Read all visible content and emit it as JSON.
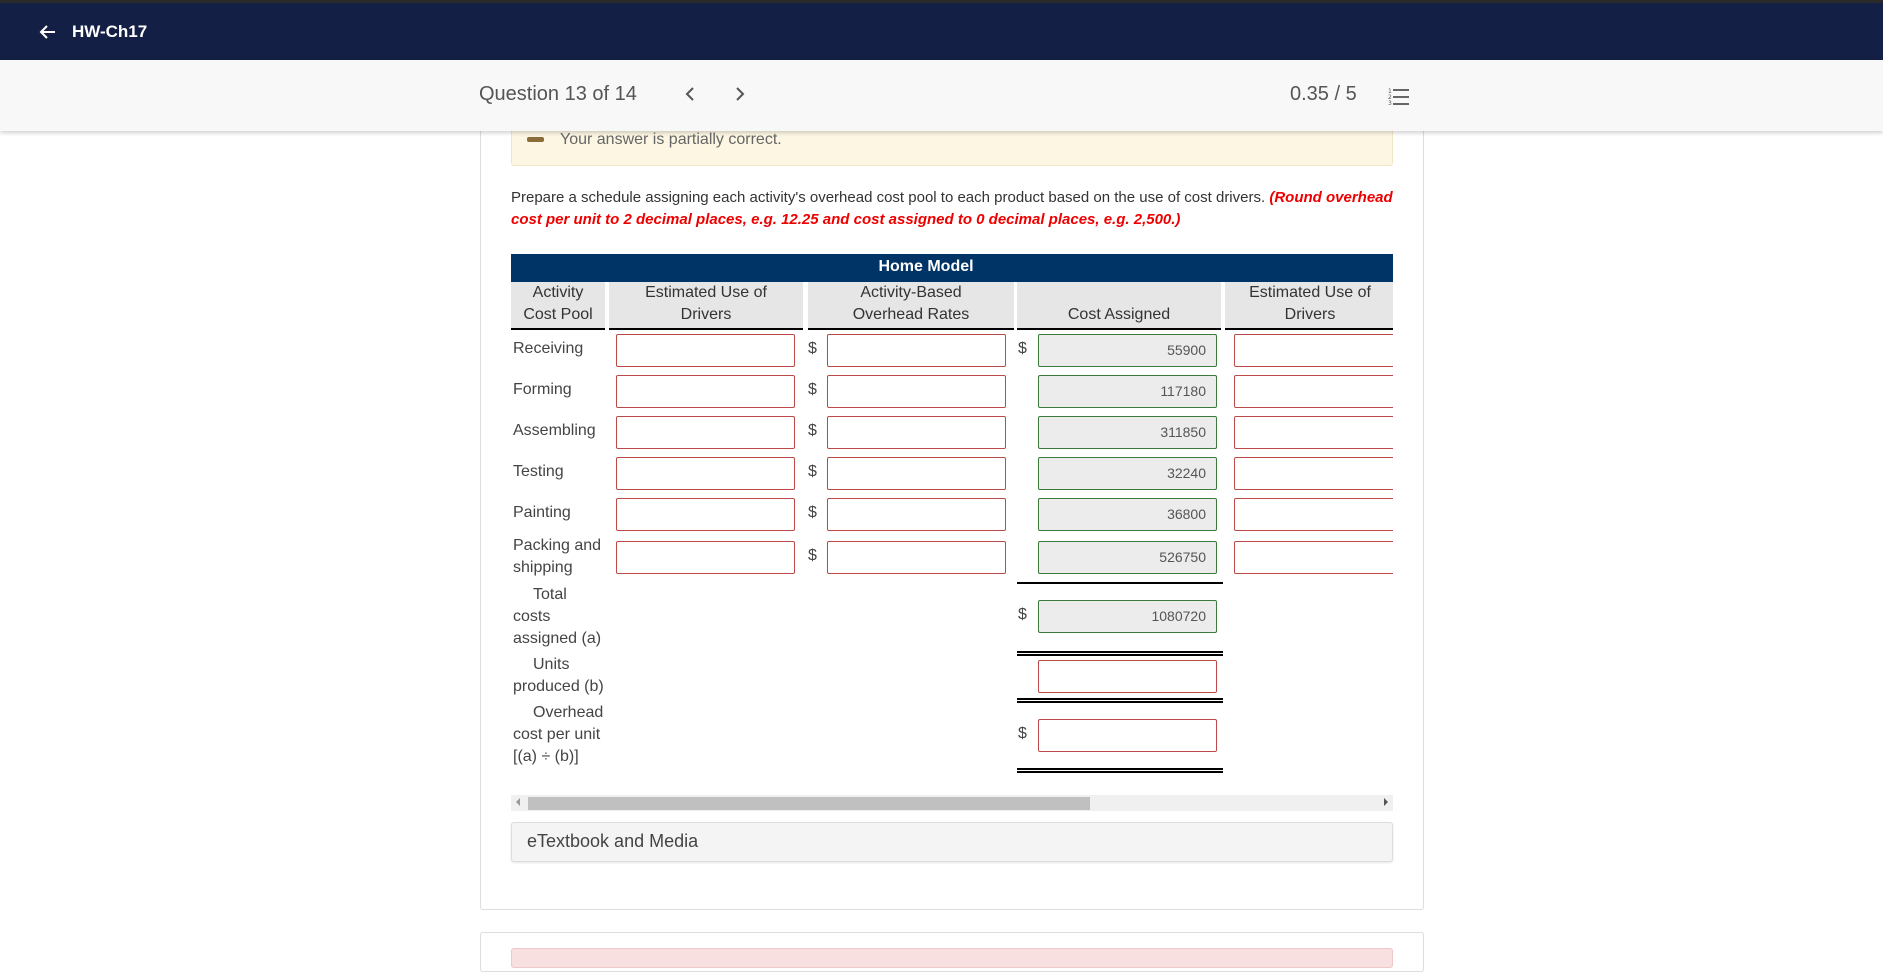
{
  "nav": {
    "title": "HW-Ch17"
  },
  "question_bar": {
    "question_label": "Question 13 of 14",
    "score": "0.35 / 5"
  },
  "alert": {
    "message": "Your answer is partially correct."
  },
  "instructions": {
    "text": "Prepare a schedule assigning each activity's overhead cost pool to each product based on the use of cost drivers. ",
    "note": "(Round overhead cost per unit to 2 decimal places, e.g. 12.25 and cost assigned to 0 decimal places, e.g. 2,500.)"
  },
  "table": {
    "group_header": "Home Model",
    "headers": {
      "activity_line1": "Activity",
      "activity_line2": "Cost Pool",
      "drivers_line1": "Estimated Use of",
      "drivers_line2": "Drivers",
      "rates_line1": "Activity-Based",
      "rates_line2": "Overhead Rates",
      "cost_assigned": "Cost Assigned",
      "next_drivers_line1": "Estimated Use of",
      "next_drivers_line2": "Drivers"
    },
    "currency": "$",
    "rows": [
      {
        "label": "Receiving",
        "drivers": "",
        "rate": "",
        "cost_assigned": "55900"
      },
      {
        "label": "Forming",
        "drivers": "",
        "rate": "",
        "cost_assigned": "117180"
      },
      {
        "label": "Assembling",
        "drivers": "",
        "rate": "",
        "cost_assigned": "311850"
      },
      {
        "label": "Testing",
        "drivers": "",
        "rate": "",
        "cost_assigned": "32240"
      },
      {
        "label": "Painting",
        "drivers": "",
        "rate": "",
        "cost_assigned": "36800"
      },
      {
        "label_line1": "Packing and",
        "label_line2": "shipping",
        "drivers": "",
        "rate": "",
        "cost_assigned": "526750"
      }
    ],
    "totals": {
      "total_label_1": "Total",
      "total_label_2": "costs",
      "total_label_3": "assigned (a)",
      "total_value": "1080720",
      "units_label_1": "Units",
      "units_label_2": "produced (b)",
      "units_value": "",
      "overhead_label_1": "Overhead",
      "overhead_label_2": "cost per unit",
      "overhead_label_3": "[(a) ÷ (b)]",
      "overhead_value": ""
    }
  },
  "etextbook": {
    "label": "eTextbook and Media"
  },
  "colors": {
    "nav_bg": "#141f45",
    "table_header_bg": "#003366",
    "incorrect_border": "#b94a48",
    "correct_border": "#3c7a3c",
    "instruction_note": "#e00000"
  }
}
